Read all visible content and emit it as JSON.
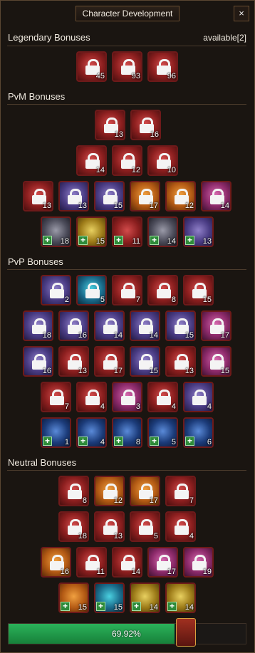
{
  "window": {
    "title": "Character Development",
    "close_label": "×"
  },
  "legendary": {
    "title": "Legendary Bonuses",
    "available": "available[2]",
    "slots": [
      {
        "value": "45"
      },
      {
        "value": "93"
      },
      {
        "value": "96"
      }
    ]
  },
  "pvm": {
    "title": "PvM Bonuses",
    "rows": [
      [
        {
          "value": "13"
        },
        {
          "value": "16"
        }
      ],
      [
        {
          "value": "14"
        },
        {
          "value": "12"
        },
        {
          "value": "10"
        }
      ],
      [
        {
          "value": "13"
        },
        {
          "value": "13"
        },
        {
          "value": "15"
        },
        {
          "value": "17"
        },
        {
          "value": "12"
        },
        {
          "value": "14"
        }
      ],
      [
        {
          "value": "18"
        },
        {
          "value": "15"
        },
        {
          "value": "11"
        },
        {
          "value": "14"
        },
        {
          "value": "13"
        }
      ]
    ]
  },
  "pvp": {
    "title": "PvP Bonuses",
    "rows": [
      [
        {
          "value": "2"
        },
        {
          "value": "5"
        },
        {
          "value": "7"
        },
        {
          "value": "8"
        },
        {
          "value": "15"
        }
      ],
      [
        {
          "value": "18"
        },
        {
          "value": "16"
        },
        {
          "value": "14"
        },
        {
          "value": "14"
        },
        {
          "value": "15"
        },
        {
          "value": "17"
        }
      ],
      [
        {
          "value": "16"
        },
        {
          "value": "13"
        },
        {
          "value": "17"
        },
        {
          "value": "15"
        },
        {
          "value": "13"
        },
        {
          "value": "15"
        }
      ],
      [
        {
          "value": "7"
        },
        {
          "value": "4"
        },
        {
          "value": "3"
        },
        {
          "value": "4"
        },
        {
          "value": "4"
        }
      ],
      [
        {
          "value": "1"
        },
        {
          "value": "4"
        },
        {
          "value": "8"
        },
        {
          "value": "5"
        },
        {
          "value": "6"
        }
      ]
    ]
  },
  "neutral": {
    "title": "Neutral Bonuses",
    "rows": [
      [
        {
          "value": "8"
        },
        {
          "value": "12"
        },
        {
          "value": "17"
        },
        {
          "value": "7"
        }
      ],
      [
        {
          "value": "18"
        },
        {
          "value": "13"
        },
        {
          "value": "5"
        },
        {
          "value": "4"
        }
      ],
      [
        {
          "value": "16"
        },
        {
          "value": "11"
        },
        {
          "value": "14"
        },
        {
          "value": "17"
        },
        {
          "value": "19"
        }
      ],
      [
        {
          "value": "15"
        },
        {
          "value": "15"
        },
        {
          "value": "14"
        },
        {
          "value": "14"
        }
      ]
    ]
  },
  "progress": {
    "percent": 69.92,
    "label": "69.92%"
  },
  "plus_label": "+"
}
